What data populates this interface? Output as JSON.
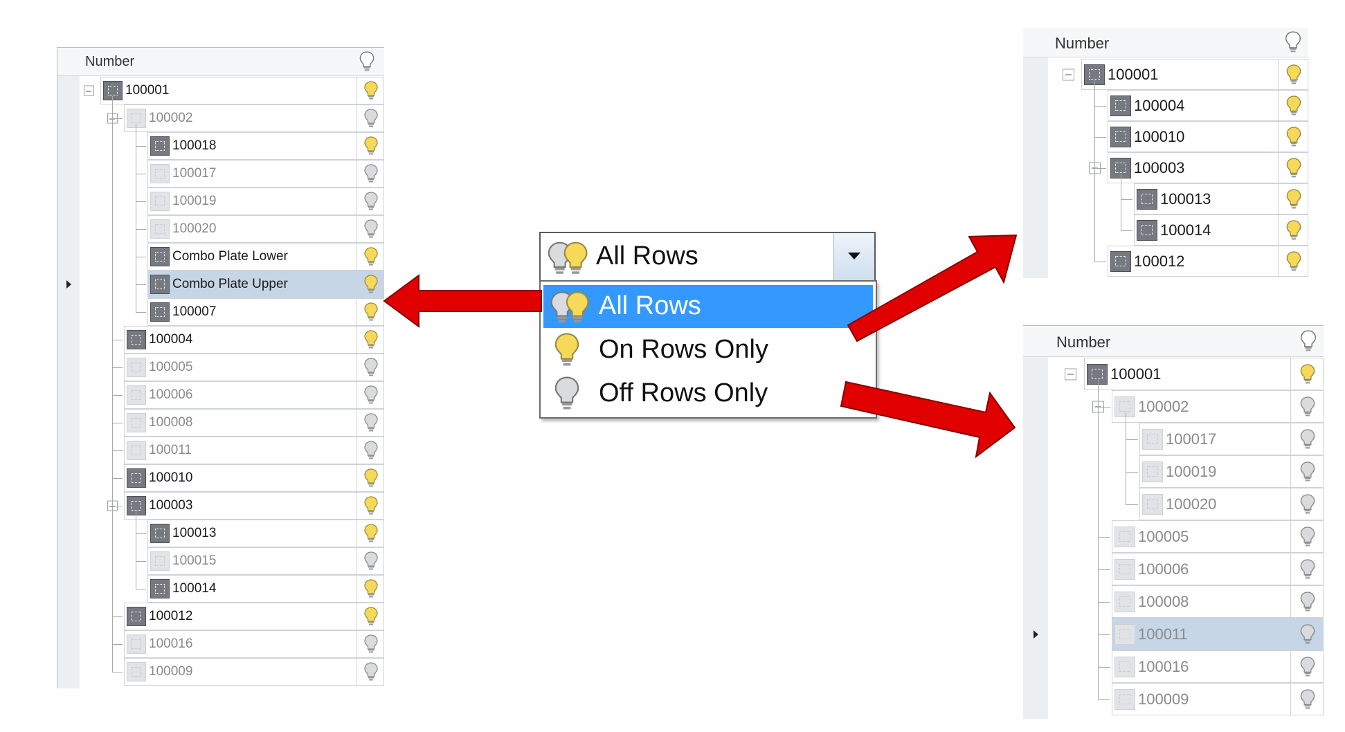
{
  "left_grid": {
    "header": "Number",
    "rows": [
      {
        "label": "100001",
        "state": "on"
      },
      {
        "label": "100002",
        "state": "off"
      },
      {
        "label": "100018",
        "state": "on"
      },
      {
        "label": "100017",
        "state": "off"
      },
      {
        "label": "100019",
        "state": "off"
      },
      {
        "label": "100020",
        "state": "off"
      },
      {
        "label": "Combo Plate Lower",
        "state": "on"
      },
      {
        "label": "Combo Plate Upper",
        "state": "on"
      },
      {
        "label": "100007",
        "state": "on"
      },
      {
        "label": "100004",
        "state": "on"
      },
      {
        "label": "100005",
        "state": "off"
      },
      {
        "label": "100006",
        "state": "off"
      },
      {
        "label": "100008",
        "state": "off"
      },
      {
        "label": "100011",
        "state": "off"
      },
      {
        "label": "100010",
        "state": "on"
      },
      {
        "label": "100003",
        "state": "on"
      },
      {
        "label": "100013",
        "state": "on"
      },
      {
        "label": "100015",
        "state": "off"
      },
      {
        "label": "100014",
        "state": "on"
      },
      {
        "label": "100012",
        "state": "on"
      },
      {
        "label": "100016",
        "state": "off"
      },
      {
        "label": "100009",
        "state": "off"
      }
    ]
  },
  "dropdown": {
    "selected": "All Rows",
    "options": [
      "All Rows",
      "On Rows Only",
      "Off Rows Only"
    ]
  },
  "on_grid": {
    "header": "Number",
    "rows": [
      {
        "label": "100001",
        "state": "on"
      },
      {
        "label": "100004",
        "state": "on"
      },
      {
        "label": "100010",
        "state": "on"
      },
      {
        "label": "100003",
        "state": "on"
      },
      {
        "label": "100013",
        "state": "on"
      },
      {
        "label": "100014",
        "state": "on"
      },
      {
        "label": "100012",
        "state": "on"
      }
    ]
  },
  "off_grid": {
    "header": "Number",
    "rows": [
      {
        "label": "100001",
        "state": "on"
      },
      {
        "label": "100002",
        "state": "off"
      },
      {
        "label": "100017",
        "state": "off"
      },
      {
        "label": "100019",
        "state": "off"
      },
      {
        "label": "100020",
        "state": "off"
      },
      {
        "label": "100005",
        "state": "off"
      },
      {
        "label": "100006",
        "state": "off"
      },
      {
        "label": "100008",
        "state": "off"
      },
      {
        "label": "100011",
        "state": "off"
      },
      {
        "label": "100016",
        "state": "off"
      },
      {
        "label": "100009",
        "state": "off"
      }
    ]
  },
  "colors": {
    "bulb_on": "#f7d95a",
    "bulb_off": "#d9dbde",
    "arrow": "#e00000",
    "highlight": "#3399ff",
    "selected_row": "#c7d6e6"
  }
}
